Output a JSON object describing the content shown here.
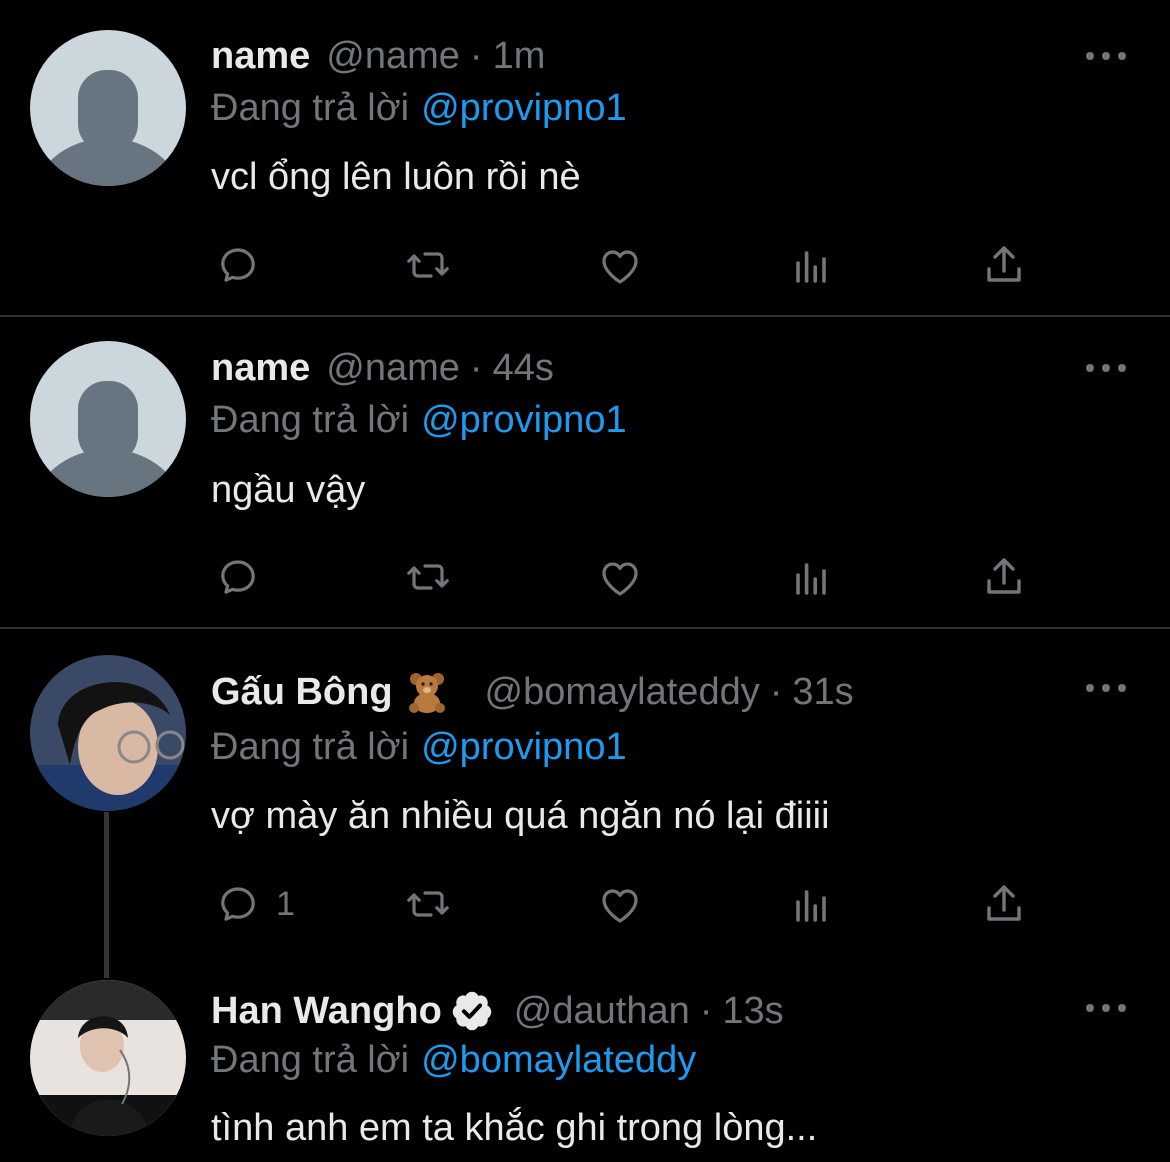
{
  "colors": {
    "background": "#000000",
    "text": "#e7e9ea",
    "muted": "#71767b",
    "accent": "#1d9bf0",
    "divider": "#2f3336"
  },
  "replying_label": "Đang trả lời",
  "tweets": [
    {
      "display_name": "name",
      "handle": "@name",
      "separator": "·",
      "time": "1m",
      "reply_to": "@provipno1",
      "text": "vcl ổng lên luôn rồi nè",
      "avatar": "default-avatar",
      "reply_count": ""
    },
    {
      "display_name": "name",
      "handle": "@name",
      "separator": "·",
      "time": "44s",
      "reply_to": "@provipno1",
      "text": "ngầu vậy",
      "avatar": "default-avatar",
      "reply_count": ""
    },
    {
      "display_name": "Gấu Bông",
      "emoji": "teddy-bear-icon",
      "handle": "@bomaylateddy",
      "separator": "·",
      "time": "31s",
      "reply_to": "@provipno1",
      "text": "vợ mày ăn nhiều quá ngăn nó lại điiii",
      "avatar": "photo-avatar",
      "reply_count": "1"
    },
    {
      "display_name": "Han Wangho",
      "verified": true,
      "handle": "@dauthan",
      "separator": "·",
      "time": "13s",
      "reply_to": "@bomaylateddy",
      "text": "tình anh em ta khắc ghi trong lòng...",
      "avatar": "photo-avatar"
    }
  ],
  "icons": [
    "reply-icon",
    "retweet-icon",
    "like-icon",
    "analytics-icon",
    "share-icon",
    "more-icon",
    "verified-icon"
  ]
}
